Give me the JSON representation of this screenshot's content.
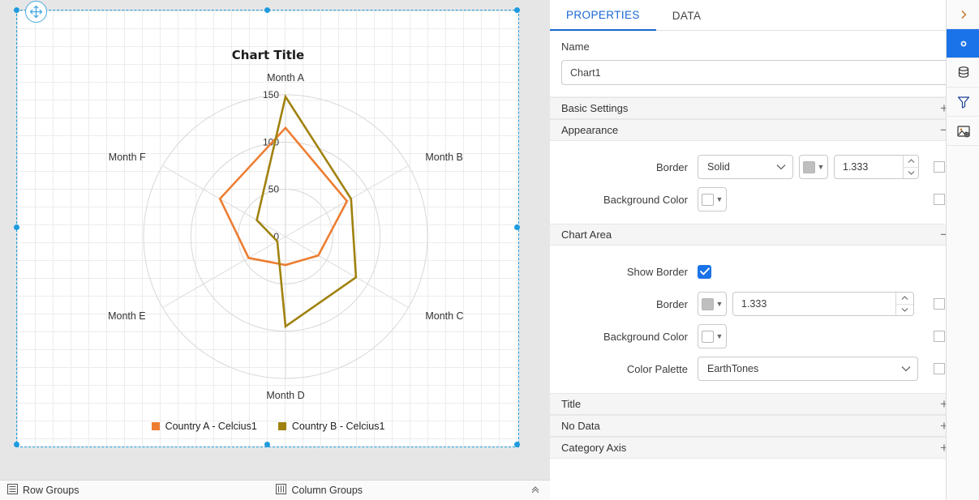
{
  "designer": {
    "move_handle_icon": "move-crosshair-icon",
    "statusbar": {
      "row_groups_label": "Row Groups",
      "row_groups_icon": "row-groups-icon",
      "column_groups_label": "Column Groups",
      "column_groups_icon": "column-groups-icon",
      "collapse_icon": "chevron-double-up-icon"
    }
  },
  "chart_data": {
    "type": "radar",
    "title": "Chart Title",
    "categories": [
      "Month A",
      "Month B",
      "Month C",
      "Month D",
      "Month E",
      "Month F"
    ],
    "rlim": [
      0,
      150
    ],
    "rticks": [
      0,
      50,
      100,
      150
    ],
    "rtick_labels": [
      "0",
      "50",
      "100",
      "150"
    ],
    "grid": true,
    "legend_position": "bottom",
    "series": [
      {
        "name": "Country A - Celcius1",
        "color": "#ED7D31",
        "values": [
          115,
          75,
          40,
          30,
          45,
          80
        ]
      },
      {
        "name": "Country B - Celcius1",
        "color": "#A0820F",
        "values": [
          148,
          80,
          86,
          95,
          10,
          35
        ]
      }
    ]
  },
  "panel": {
    "tabs": [
      {
        "label": "PROPERTIES",
        "active": true
      },
      {
        "label": "DATA",
        "active": false
      }
    ],
    "name": {
      "label": "Name",
      "value": "Chart1",
      "placeholder": "Name"
    },
    "sections": {
      "basic_settings": {
        "title": "Basic Settings",
        "toggle": "+"
      },
      "appearance": {
        "title": "Appearance",
        "toggle": "−",
        "border_label": "Border",
        "border_style": "Solid",
        "border_color": "#bfbfbf",
        "border_width": "1.333",
        "background_label": "Background Color",
        "background_color": "#ffffff"
      },
      "chart_area": {
        "title": "Chart Area",
        "toggle": "−",
        "show_border_label": "Show Border",
        "show_border_checked": true,
        "border_label": "Border",
        "border_color": "#bfbfbf",
        "border_width": "1.333",
        "background_label": "Background Color",
        "background_color": "#ffffff",
        "palette_label": "Color Palette",
        "palette_value": "EarthTones"
      },
      "title": {
        "title": "Title",
        "toggle": "+"
      },
      "no_data": {
        "title": "No Data",
        "toggle": "+"
      },
      "category_axis": {
        "title": "Category Axis",
        "toggle": "+"
      }
    }
  },
  "rail": {
    "buttons": [
      {
        "icon": "chevron-right-icon",
        "active": false
      },
      {
        "icon": "gear-icon",
        "active": true
      },
      {
        "icon": "database-icon",
        "active": false
      },
      {
        "icon": "filter-funnel-icon",
        "active": false
      },
      {
        "icon": "image-settings-icon",
        "active": false
      }
    ]
  },
  "accent": "#1a73e8"
}
